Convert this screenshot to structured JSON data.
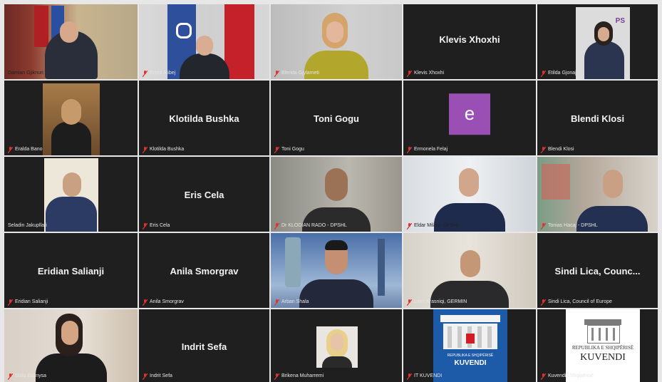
{
  "participants": [
    {
      "caption": "Damian Gjiknuri",
      "active": true
    },
    {
      "caption": "Erisld Alibej"
    },
    {
      "caption": "Blerida Gjylameti"
    },
    {
      "caption": "Klevis Xhoxhi",
      "center_name": "Klevis Xhoxhi"
    },
    {
      "caption": "Etilda Gjonaj",
      "overlay": "PS"
    },
    {
      "caption": "Eralda Bano"
    },
    {
      "caption": "Klotilda Bushka",
      "center_name": "Klotilda Bushka"
    },
    {
      "caption": "Toni Gogu",
      "center_name": "Toni Gogu"
    },
    {
      "caption": "Ermonela Felaj",
      "avatar_letter": "e",
      "avatar_color": "#9a4fb4"
    },
    {
      "caption": "Blendi Klosi",
      "center_name": "Blendi Klosi"
    },
    {
      "caption": "Seladin Jakupllari"
    },
    {
      "caption": "Eris Cela",
      "center_name": "Eris Cela"
    },
    {
      "caption": "Dr KLODIAN RADO - DPSHL"
    },
    {
      "caption": "Eldar Milaqi- DPSHL"
    },
    {
      "caption": "Tonias Hacaj - DPSHL"
    },
    {
      "caption": "Eridian Salianji",
      "center_name": "Eridian Salianji"
    },
    {
      "caption": "Anila Smorgrav",
      "center_name": "Anila Smorgrav"
    },
    {
      "caption": "Arban Shala"
    },
    {
      "caption": "Lirim Krasniqi, GERMIN"
    },
    {
      "caption": "Sindi Lica, Council of Europe",
      "center_name": "Sindi Lica, Counc..."
    },
    {
      "caption": "Shila Balinysa"
    },
    {
      "caption": "Indrit Sefa",
      "center_name": "Indrit Sefa"
    },
    {
      "caption": "Brikena Muharremi"
    },
    {
      "caption": "IT KUVENDI"
    },
    {
      "caption": "Kuvendi i Shqipërisë"
    }
  ],
  "logos": {
    "kuvendi_blue": {
      "line1": "REPUBLIKA E SHQIPËRISË",
      "line2": "KUVENDI"
    },
    "kuvendi_white": {
      "line1": "REPUBLIKA E SHQIPËRISË",
      "line2": "KUVENDI"
    }
  },
  "colors": {
    "active_border": "#d9d236",
    "tile_bg": "#1f1f1f",
    "mic_muted": "#e0322f"
  }
}
